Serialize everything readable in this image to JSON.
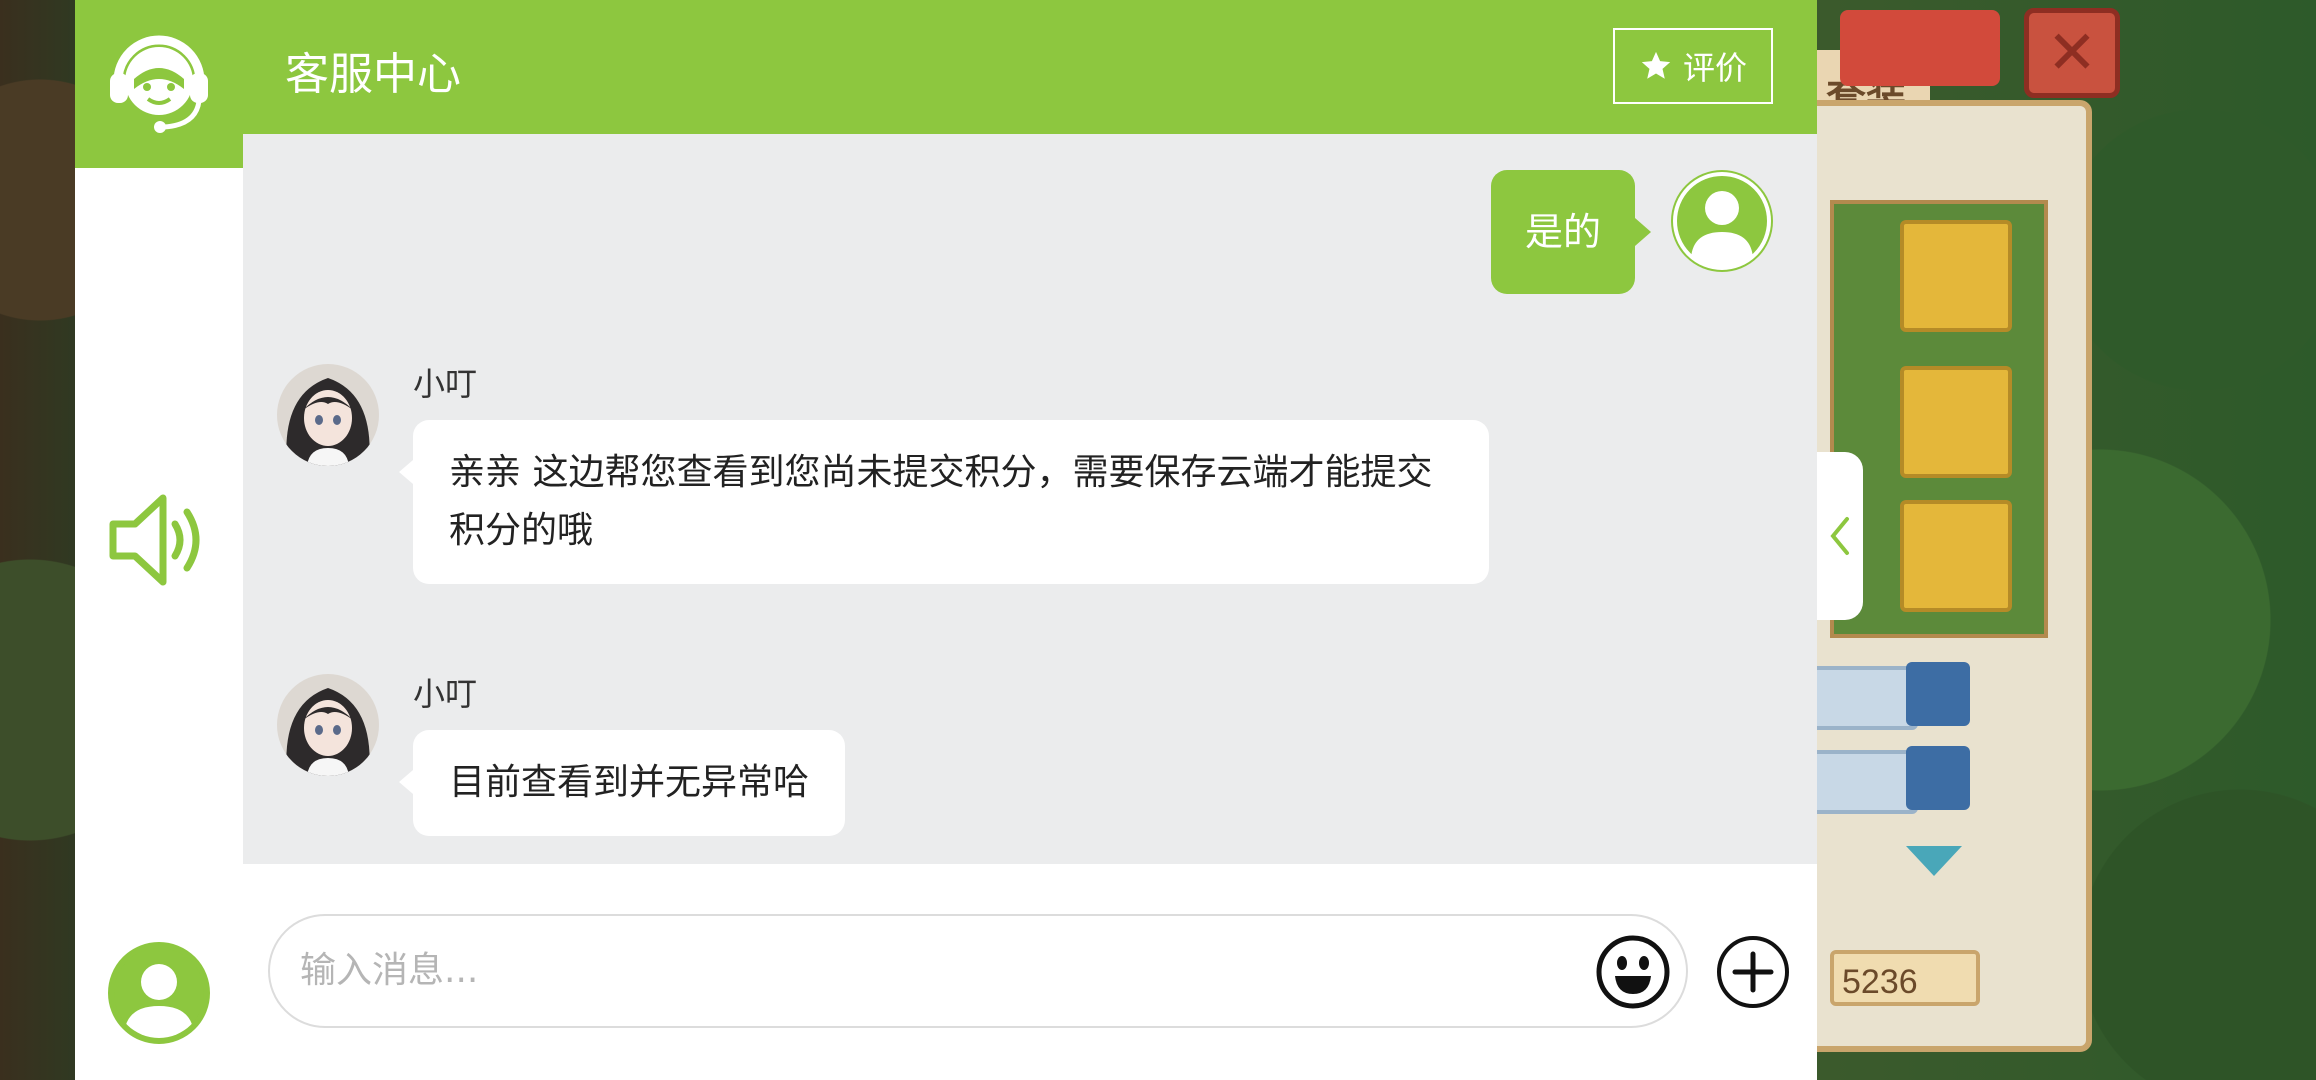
{
  "header": {
    "title": "客服中心",
    "rate_label": "评价"
  },
  "messages": [
    {
      "sender": "user",
      "text": "是的"
    },
    {
      "sender": "agent",
      "name": "小叮",
      "text": "亲亲 这边帮您查看到您尚未提交积分，需要保存云端才能提交积分的哦"
    },
    {
      "sender": "agent",
      "name": "小叮",
      "text": "目前查看到并无异常哈"
    }
  ],
  "input": {
    "placeholder": "输入消息..."
  },
  "game": {
    "title_fragment": "套装",
    "score": "5236"
  },
  "colors": {
    "accent": "#8dc73f",
    "chat_bg": "#ebeced"
  },
  "icons": [
    "headset-icon",
    "star-icon",
    "user-icon",
    "speaker-icon",
    "emoji-icon",
    "plus-icon",
    "chevron-left-icon"
  ]
}
